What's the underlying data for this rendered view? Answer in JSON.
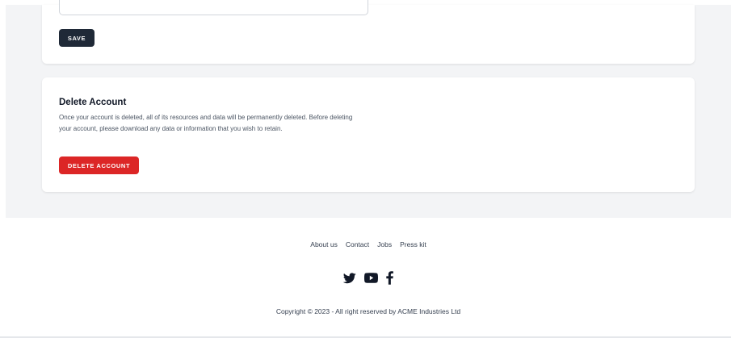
{
  "profile_form": {
    "save_label": "SAVE"
  },
  "delete_account": {
    "title": "Delete Account",
    "description": "Once your account is deleted, all of its resources and data will be permanently deleted. Before deleting your account, please download any data or information that you wish to retain.",
    "button_label": "DELETE ACCOUNT"
  },
  "footer": {
    "links": [
      "About us",
      "Contact",
      "Jobs",
      "Press kit"
    ],
    "social_icons": [
      "twitter-icon",
      "youtube-icon",
      "facebook-icon"
    ],
    "copyright": "Copyright © 2023 - All right reserved by ACME Industries Ltd"
  },
  "colors": {
    "page_background": "#f3f4f6",
    "save_button": "#1f2937",
    "delete_button": "#dc2626",
    "card": "#ffffff"
  }
}
